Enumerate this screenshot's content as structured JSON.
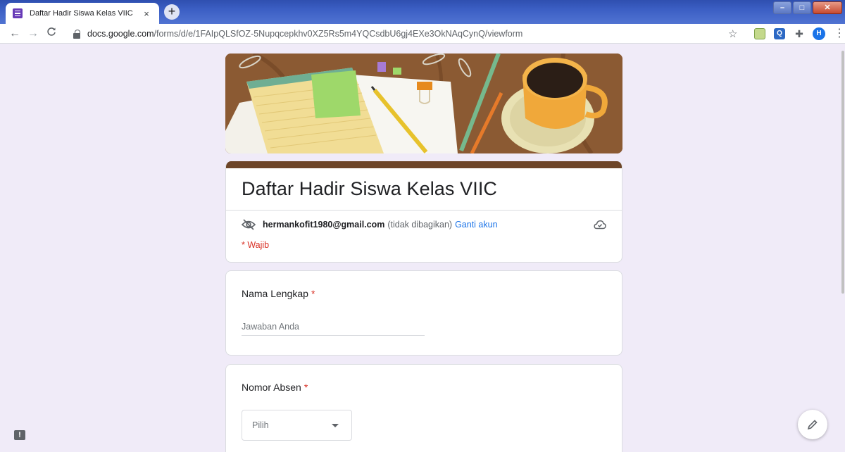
{
  "browser": {
    "tab_title": "Daftar Hadir Siswa Kelas VIIC",
    "tab_close": "×",
    "new_tab": "+",
    "url_host": "docs.google.com",
    "url_path": "/forms/d/e/1FAIpQLSfOZ-5Nupqcepkhv0XZ5Rs5m4YQCsdbU6gj4EXe3OkNAqCynQ/viewform",
    "profile_initial": "H",
    "window_buttons": [
      "–",
      "□",
      "✕"
    ],
    "icons": [
      "back-icon",
      "forward-icon",
      "reload-icon",
      "lock-icon",
      "bookmark-star-icon",
      "extension-icon",
      "search-extension-icon",
      "puzzle-icon",
      "kebab-menu-icon"
    ]
  },
  "form": {
    "title": "Daftar Hadir Siswa Kelas VIIC",
    "account_email": "hermankofit1980@gmail.com",
    "share_note": "(tidak dibagikan)",
    "switch_account": "Ganti akun",
    "required_note": "* Wajib",
    "header_color": "#6d4528",
    "background_color": "#f0ebf8"
  },
  "questions": [
    {
      "label": "Nama Lengkap",
      "required_mark": "*",
      "type": "short-answer",
      "placeholder": "Jawaban Anda"
    },
    {
      "label": "Nomor Absen",
      "required_mark": "*",
      "type": "dropdown",
      "selected": "Pilih"
    }
  ],
  "floating": {
    "feedback": "!",
    "edit_icon": "pencil-icon"
  }
}
